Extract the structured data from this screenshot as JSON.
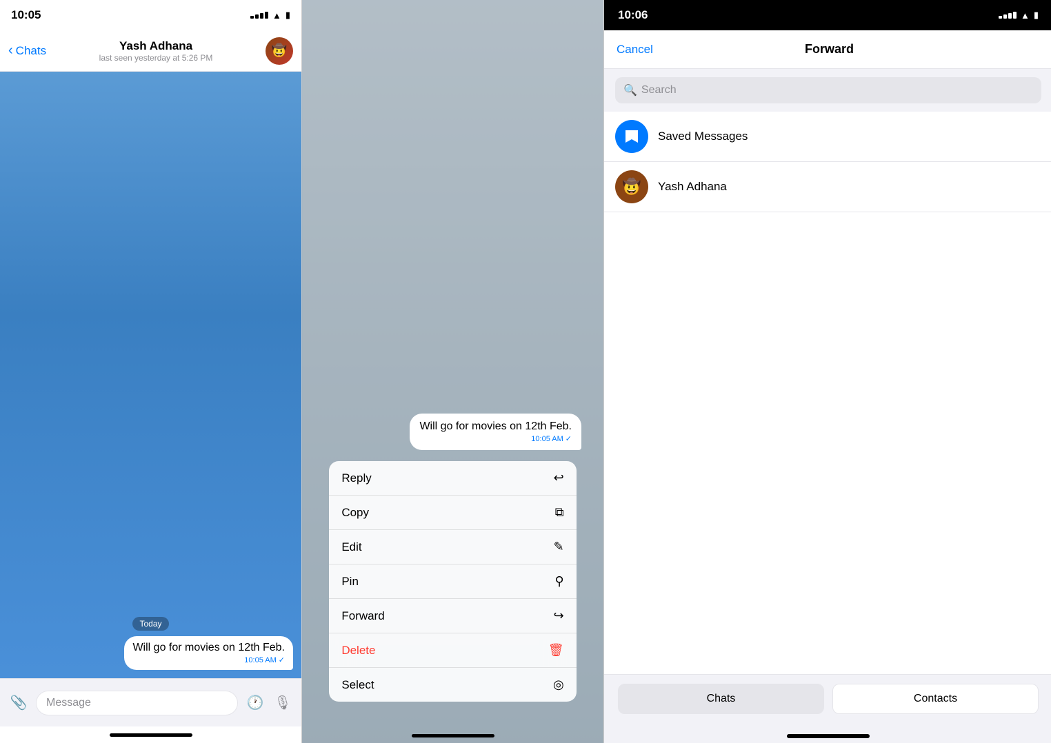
{
  "panel1": {
    "status_time": "10:05",
    "back_label": "Chats",
    "contact_name": "Yash Adhana",
    "contact_status": "last seen yesterday at 5:26 PM",
    "date_badge": "Today",
    "message_text": "Will go for movies on 12th Feb.",
    "message_time": "10:05 AM",
    "input_placeholder": "Message"
  },
  "panel2": {
    "message_text": "Will go for movies on 12th Feb.",
    "message_time": "10:05 AM",
    "menu_items": [
      {
        "label": "Reply",
        "icon": "↩",
        "style": "normal"
      },
      {
        "label": "Copy",
        "icon": "⧉",
        "style": "normal"
      },
      {
        "label": "Edit",
        "icon": "✎",
        "style": "normal"
      },
      {
        "label": "Pin",
        "icon": "📌",
        "style": "normal"
      },
      {
        "label": "Forward",
        "icon": "↪",
        "style": "normal"
      },
      {
        "label": "Delete",
        "icon": "🗑",
        "style": "delete"
      },
      {
        "label": "Select",
        "icon": "◎",
        "style": "normal"
      }
    ]
  },
  "panel3": {
    "status_time": "10:06",
    "cancel_label": "Cancel",
    "forward_title": "Forward",
    "search_placeholder": "Search",
    "contacts": [
      {
        "name": "Saved Messages",
        "type": "saved"
      },
      {
        "name": "Yash Adhana",
        "type": "user"
      }
    ],
    "tab_chats": "Chats",
    "tab_contacts": "Contacts"
  }
}
